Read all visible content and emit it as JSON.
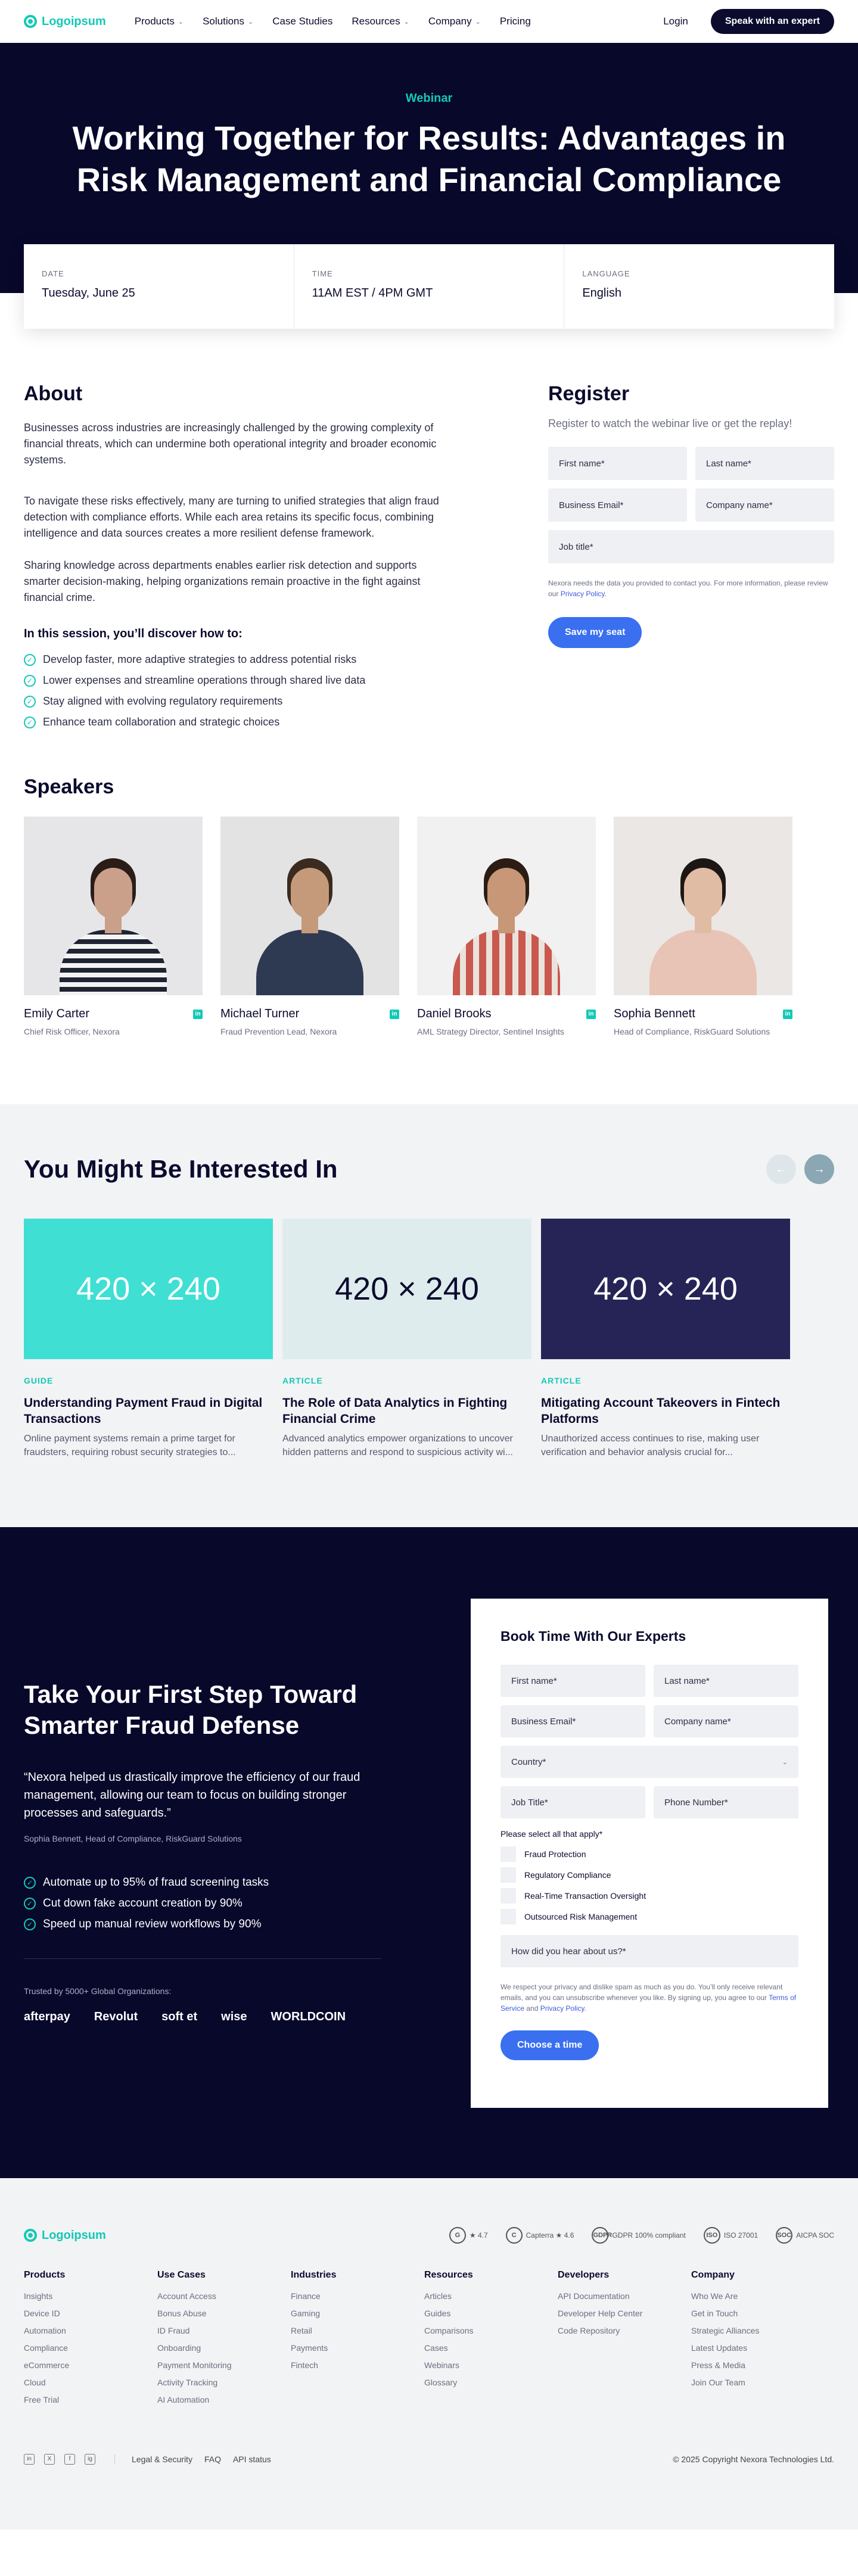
{
  "nav": {
    "logo": "Logoipsum",
    "links": [
      "Products",
      "Solutions",
      "Case Studies",
      "Resources",
      "Company",
      "Pricing"
    ],
    "has_dropdown": [
      true,
      true,
      false,
      true,
      true,
      false
    ],
    "login": "Login",
    "cta": "Speak with an expert"
  },
  "hero": {
    "tag": "Webinar",
    "title": "Working Together for Results: Advantages in Risk Management and Financial Compliance"
  },
  "info": {
    "date_label": "DATE",
    "date": "Tuesday, June 25",
    "time_label": "TIME",
    "time": "11AM EST / 4PM GMT",
    "lang_label": "LANGUAGE",
    "lang": "English"
  },
  "about": {
    "title": "About",
    "p1": "Businesses across industries are increasingly challenged by the growing complexity of financial threats, which can undermine both operational integrity and broader economic systems.",
    "p2": "To navigate these risks effectively, many are turning to unified strategies that align fraud detection with compliance efforts. While each area retains its specific focus, combining intelligence and data sources creates a more resilient defense framework.",
    "p3": "Sharing knowledge across departments enables earlier risk detection and supports smarter decision-making, helping organizations remain proactive in the fight against financial crime.",
    "list_title": "In this session, you’ll discover how to:",
    "items": [
      "Develop faster, more adaptive strategies to address potential risks",
      "Lower expenses and streamline operations through shared live data",
      "Stay aligned with evolving regulatory requirements",
      "Enhance team collaboration and strategic choices"
    ]
  },
  "register": {
    "title": "Register",
    "sub": "Register to watch the webinar live or get the replay!",
    "first": "First name*",
    "last": "Last name*",
    "email": "Business Email*",
    "company": "Company name*",
    "job": "Job title*",
    "fine": "Nexora needs the data you provided to contact you. For more information, please review our",
    "privacy": "Privacy Policy",
    "submit": "Save my seat"
  },
  "speakers": {
    "title": "Speakers",
    "list": [
      {
        "name": "Emily Carter",
        "role": "Chief Risk Officer, Nexora"
      },
      {
        "name": "Michael Turner",
        "role": "Fraud Prevention Lead, Nexora"
      },
      {
        "name": "Daniel Brooks",
        "role": "AML Strategy Director, Sentinel Insights"
      },
      {
        "name": "Sophia Bennett",
        "role": "Head of Compliance, RiskGuard Solutions"
      }
    ]
  },
  "related": {
    "title": "You Might Be Interested In",
    "cards": [
      {
        "thumb": "420 × 240",
        "color": "#3fdfd3",
        "kind": "GUIDE",
        "title": "Understanding Payment Fraud in Digital Transactions",
        "desc": "Online payment systems remain a prime target for fraudsters, requiring robust security strategies to..."
      },
      {
        "thumb": "420 × 240",
        "color": "#dfeced",
        "kind": "ARTICLE",
        "title": "The Role of Data Analytics in Fighting Financial Crime",
        "desc": "Advanced analytics empower organizations to uncover hidden patterns and respond to suspicious activity wi..."
      },
      {
        "thumb": "420 × 240",
        "color": "#262456",
        "kind": "ARTICLE",
        "title": "Mitigating Account Takeovers in Fintech Platforms",
        "desc": "Unauthorized access continues to rise, making user verification and behavior analysis crucial for..."
      }
    ]
  },
  "cta": {
    "title": "Take Your First Step Toward Smarter Fraud Defense",
    "quote": "“Nexora helped us drastically improve the efficiency of our fraud management, allowing our team to focus on building stronger processes and safeguards.”",
    "by": "Sophia Bennett, Head of Compliance, RiskGuard Solutions",
    "items": [
      "Automate up to 95% of fraud screening tasks",
      "Cut down fake account creation by 90%",
      "Speed up manual review workflows by 90%"
    ],
    "trusted": "Trusted by 5000+ Global Organizations:",
    "brands": [
      "afterpay",
      "Revolut",
      "soft et",
      "wise",
      "WORLDCOIN"
    ]
  },
  "book": {
    "title": "Book Time With Our Experts",
    "first": "First name*",
    "last": "Last name*",
    "email": "Business Email*",
    "company": "Company name*",
    "country": "Country*",
    "job": "Job Title*",
    "phone": "Phone Number*",
    "ask": "Please select all that apply*",
    "options": [
      "Fraud Protection",
      "Regulatory Compliance",
      "Real-Time Transaction Oversight",
      "Outsourced Risk Management"
    ],
    "hear": "How did you hear about us?*",
    "fine1": "We respect your privacy and dislike spam as much as you do. You’ll only receive relevant emails, and you can unsubscribe whenever you like. By signing up, you agree to our",
    "terms": "Terms of Service",
    "and": "and",
    "privacy": "Privacy Policy",
    "submit": "Choose a time"
  },
  "footer": {
    "logo": "Logoipsum",
    "badges": [
      {
        "icon": "G",
        "text": "★ 4.7"
      },
      {
        "icon": "C",
        "text": "Capterra ★ 4.6"
      },
      {
        "icon": "GDPR",
        "text": "GDPR 100% compliant"
      },
      {
        "icon": "ISO",
        "text": "ISO 27001"
      },
      {
        "icon": "SOC",
        "text": "AICPA SOC"
      }
    ],
    "cols": [
      {
        "title": "Products",
        "items": [
          "Insights",
          "Device ID",
          "Automation",
          "Compliance",
          "eCommerce",
          "Cloud",
          "Free Trial"
        ]
      },
      {
        "title": "Use Cases",
        "items": [
          "Account Access",
          "Bonus Abuse",
          "ID Fraud",
          "Onboarding",
          "Payment Monitoring",
          "Activity Tracking",
          "AI Automation"
        ]
      },
      {
        "title": "Industries",
        "items": [
          "Finance",
          "Gaming",
          "Retail",
          "Payments",
          "Fintech"
        ]
      },
      {
        "title": "Resources",
        "items": [
          "Articles",
          "Guides",
          "Comparisons",
          "Cases",
          "Webinars",
          "Glossary"
        ]
      },
      {
        "title": "Developers",
        "items": [
          "API Documentation",
          "Developer Help Center",
          "Code Repository"
        ]
      },
      {
        "title": "Company",
        "items": [
          "Who We Are",
          "Get in Touch",
          "Strategic Alliances",
          "Latest Updates",
          "Press & Media",
          "Join Our Team"
        ]
      }
    ],
    "social": [
      "in",
      "X",
      "f",
      "ig"
    ],
    "links": [
      "Legal & Security",
      "FAQ",
      "API status"
    ],
    "copy": "© 2025 Copyright Nexora Technologies Ltd."
  }
}
